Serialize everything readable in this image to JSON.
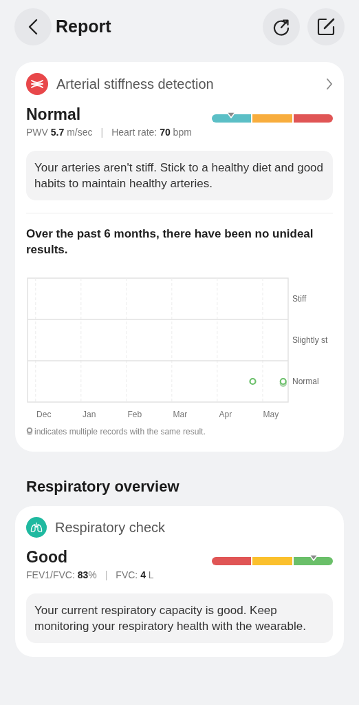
{
  "header": {
    "title": "Report"
  },
  "arterial_card": {
    "title": "Arterial stiffness detection",
    "status": "Normal",
    "gauge": {
      "level": 0.16,
      "segments": [
        {
          "color": "#5bbfc6"
        },
        {
          "color": "#f8ad3d"
        },
        {
          "color": "#e05555"
        }
      ]
    },
    "metrics": [
      "PWV **5.7** m/sec",
      "Heart rate: **70** bpm"
    ],
    "metrics_separator": "|",
    "advice": "Your arteries aren't stiff. Stick to a healthy diet and good habits to maintain healthy arteries.",
    "summary": "Over the past 6 months, there have been no unideal results.",
    "trend_chart": {
      "month_labels": [
        "Dec",
        "Jan",
        "Feb",
        "Mar",
        "Apr",
        "May"
      ],
      "level_labels": [
        "Stiff",
        "Slightly st",
        "Normal"
      ]
    },
    "legend_note": "indicates multiple records with the same result."
  },
  "section_title": "Respiratory overview",
  "respiratory_card": {
    "title": "Respiratory check",
    "status": "Good",
    "gauge": {
      "level": 0.84,
      "segments": [
        {
          "color": "#e05555"
        },
        {
          "color": "#fbc02d"
        },
        {
          "color": "#6abf69"
        }
      ]
    },
    "metrics": [
      "FEV1/FVC: **83**%",
      "FVC: **4** L"
    ],
    "metrics_separator": "|",
    "advice": "Your current respiratory capacity is good. Keep monitoring your respiratory health with the wearable."
  }
}
